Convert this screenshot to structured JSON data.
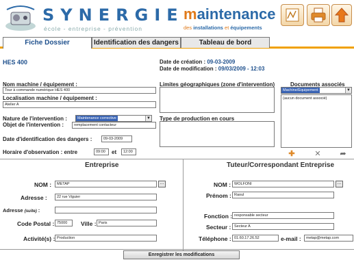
{
  "header": {
    "brand": "SYNERGIE",
    "tagline": "école - entreprise - prévention",
    "maintenance_title_m": "m",
    "maintenance_title_rest": "aintenance",
    "maintenance_sub_pre": "des ",
    "maintenance_sub_b1": "installations",
    "maintenance_sub_mid": " et ",
    "maintenance_sub_b2": "équipements",
    "buttons": [
      "draw-icon",
      "print-icon",
      "upload-icon"
    ]
  },
  "tabs": [
    {
      "label": "Fiche Dossier",
      "active": true
    },
    {
      "label": "Identification des dangers",
      "active": false
    },
    {
      "label": "Tableau de bord",
      "active": false
    }
  ],
  "dossier": {
    "title": "HES 400",
    "creation_label": "Date de création : ",
    "creation_value": "09-03-2009",
    "modification_label": "Date de modification : ",
    "modification_value": "09/03/2009 - 12:03"
  },
  "left": {
    "machine_label": "Nom machine / équipement :",
    "machine_value": "Tour à commande numérique HES 400",
    "localisation_label": "Localisation machine / équipement :",
    "localisation_value": "Atelier A",
    "nature_label": "Nature de l'intervention :",
    "nature_value": "Maintenance corrective",
    "objet_label": "Objet de l'intervention :",
    "objet_value": "remplacement contacteur",
    "date_ident_label": "Date d'identification des dangers :",
    "date_ident_value": "09-03-2009",
    "horaire_label": "Horaire d'observation : entre",
    "horaire_start": "09:00",
    "horaire_et": "et",
    "horaire_end": "12:00"
  },
  "middle": {
    "limites_label": "Limites géographiques (zone d'intervention)",
    "production_label": "Type de production en cours"
  },
  "documents": {
    "label": "Documents associés",
    "select_value": "Machine/Equipement",
    "list_item": "(aucun document associé)",
    "icons": [
      "add-document-icon",
      "delete-document-icon",
      "open-document-icon"
    ]
  },
  "entreprise": {
    "title": "Entreprise",
    "nom_label": "NOM :",
    "nom_value": "METAP",
    "adresse_label": "Adresse :",
    "adresse_value": "22 rue Viguier",
    "adresse_suite_label": "Adresse",
    "adresse_suite_hint": "(suite)",
    "adresse_suite_colon": " :",
    "adresse_suite_value": "",
    "cp_label": "Code Postal :",
    "cp_value": "75000",
    "ville_label": "Ville :",
    "ville_value": "Paris",
    "activite_label": "Activité(s) :",
    "activite_value": "Production",
    "dots": "..."
  },
  "tuteur": {
    "title": "Tuteur/Correspondant Entreprise",
    "nom_label": "NOM :",
    "nom_value": "WOLFONI",
    "prenom_label": "Prénom :",
    "prenom_value": "Raoul",
    "fonction_label": "Fonction :",
    "fonction_value": "responsable secteur",
    "secteur_label": "Secteur :",
    "secteur_value": "Secteur A",
    "tel_label": "Téléphone :",
    "tel_value": "01.60.17.26.52",
    "email_label": "e-mail :",
    "email_value": "metap@metap.com",
    "dots": "..."
  },
  "save_label": "Enregistrer les modifications",
  "colors": {
    "brand_blue": "#2c6aa8",
    "accent_orange": "#e07a1a",
    "tab_underline": "#f0a000"
  }
}
